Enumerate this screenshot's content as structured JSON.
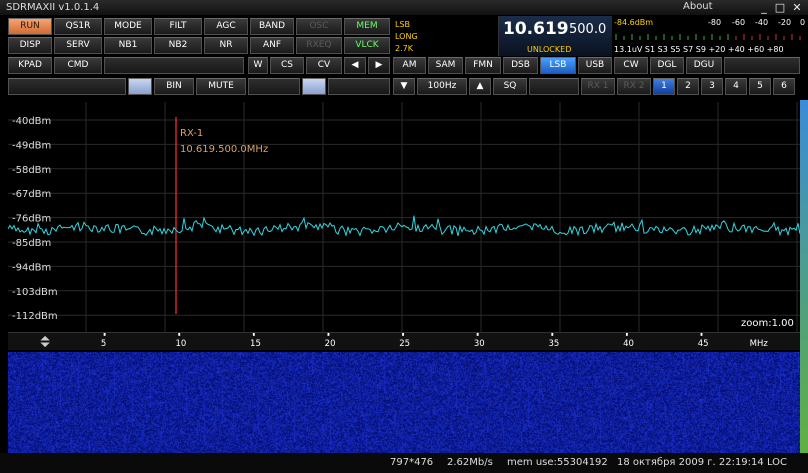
{
  "window": {
    "title": "SDRMAXII v1.0.1.4",
    "about": "About"
  },
  "row1": [
    "RUN",
    "QS1R",
    "MODE",
    "FILT",
    "AGC",
    "BAND",
    "OSC",
    "MEM"
  ],
  "row1_extra": "VLCK",
  "row2": [
    "DISP",
    "SERV",
    "NB1",
    "NB2",
    "NR",
    "ANF",
    "RXEQ"
  ],
  "row3": [
    "KPAD",
    "CMD",
    "W",
    "CS",
    "CV"
  ],
  "modes": [
    "AM",
    "SAM",
    "FMN",
    "DSB",
    "LSB",
    "USB",
    "CW",
    "DGL",
    "DGU"
  ],
  "row4": {
    "bin": "BIN",
    "mute": "MUTE",
    "step": "100Hz",
    "sq": "SQ",
    "rx1": "RX 1",
    "rx2": "RX 2",
    "nums": [
      "1",
      "2",
      "3",
      "4",
      "5",
      "6"
    ]
  },
  "info": {
    "mode": "LSB",
    "agc": "LONG",
    "filter": "2.7K"
  },
  "freq": {
    "main": "10.619",
    "sub": "500.0",
    "lock": "UNLOCKED"
  },
  "smeter": {
    "dbm": "-84.6dBm",
    "top": [
      "-80",
      "-60",
      "-40",
      "-20",
      "0"
    ],
    "bottom": "13.1uV S1 S3 S5 S7 S9  +20 +40 +60 +80"
  },
  "spectrum": {
    "dbm_labels": [
      "-40dBm",
      "-49dBm",
      "-58dBm",
      "-67dBm",
      "-76dBm",
      "-85dBm",
      "-94dBm",
      "-103dBm",
      "-112dBm"
    ],
    "marker_label": "RX-1",
    "marker_freq": "10.619.500.0MHz",
    "zoom": "zoom:1.00"
  },
  "freq_axis": {
    "ticks": [
      "5",
      "10",
      "15",
      "20",
      "25",
      "30",
      "35",
      "40",
      "45"
    ],
    "unit": "MHz"
  },
  "status": {
    "res": "797*476",
    "rate": "2.62Mb/s",
    "mem": "mem use:55304192",
    "date": "18 октября 2009 г. 22:19:14 LOC"
  },
  "colors": {
    "trace": "#33d6e0",
    "marker": "#ff3030",
    "accent": "#d06a34",
    "waterfall": "#10208a"
  }
}
